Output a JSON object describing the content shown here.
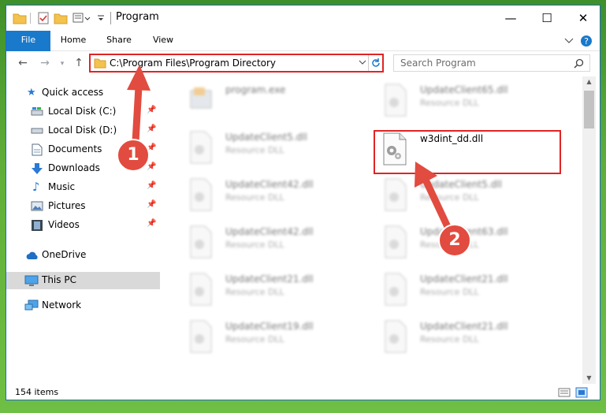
{
  "window": {
    "title": "Program",
    "controls": {
      "minimize": "—",
      "maximize": "☐",
      "close": "✕"
    }
  },
  "ribbon": {
    "tabs": [
      {
        "label": "File"
      },
      {
        "label": "Home"
      },
      {
        "label": "Share"
      },
      {
        "label": "View"
      }
    ]
  },
  "address_bar": {
    "path": "C:\\Program Files\\Program Directory"
  },
  "search": {
    "placeholder": "Search Program"
  },
  "sidebar": {
    "items": [
      {
        "label": "Quick access",
        "icon": "star-icon"
      },
      {
        "label": "Local Disk (C:)",
        "icon": "drive-icon"
      },
      {
        "label": "Local Disk (D:)",
        "icon": "drive-icon"
      },
      {
        "label": "Documents",
        "icon": "documents-icon"
      },
      {
        "label": "Downloads",
        "icon": "downloads-icon"
      },
      {
        "label": "Music",
        "icon": "music-icon"
      },
      {
        "label": "Pictures",
        "icon": "pictures-icon"
      },
      {
        "label": "Videos",
        "icon": "videos-icon"
      },
      {
        "label": "OneDrive",
        "icon": "cloud-icon"
      },
      {
        "label": "This PC",
        "icon": "computer-icon"
      },
      {
        "label": "Network",
        "icon": "network-icon"
      }
    ]
  },
  "files": [
    {
      "name": "program.exe",
      "type": ""
    },
    {
      "name": "UpdateClient65.dll",
      "type": "Resource DLL"
    },
    {
      "name": "UpdateClient5.dll",
      "type": "Resource DLL"
    },
    {
      "name": "w3dint_dd.dll",
      "type": ""
    },
    {
      "name": "UpdateClient42.dll",
      "type": "Resource DLL"
    },
    {
      "name": "UpdateClient5.dll",
      "type": "Resource DLL"
    },
    {
      "name": "UpdateClient42.dll",
      "type": "Resource DLL"
    },
    {
      "name": "UpdateClient63.dll",
      "type": "Resource DLL"
    },
    {
      "name": "UpdateClient21.dll",
      "type": "Resource DLL"
    },
    {
      "name": "UpdateClient21.dll",
      "type": "Resource DLL"
    },
    {
      "name": "UpdateClient19.dll",
      "type": "Resource DLL"
    },
    {
      "name": "UpdateClient21.dll",
      "type": "Resource DLL"
    }
  ],
  "status": {
    "item_count": "154 items"
  },
  "callouts": {
    "step1": "1",
    "step2": "2"
  },
  "colors": {
    "accent": "#1979ca",
    "annotation_red": "#e02424",
    "callout_red": "#e24b3f",
    "desktop_green": "#5fae3a"
  }
}
